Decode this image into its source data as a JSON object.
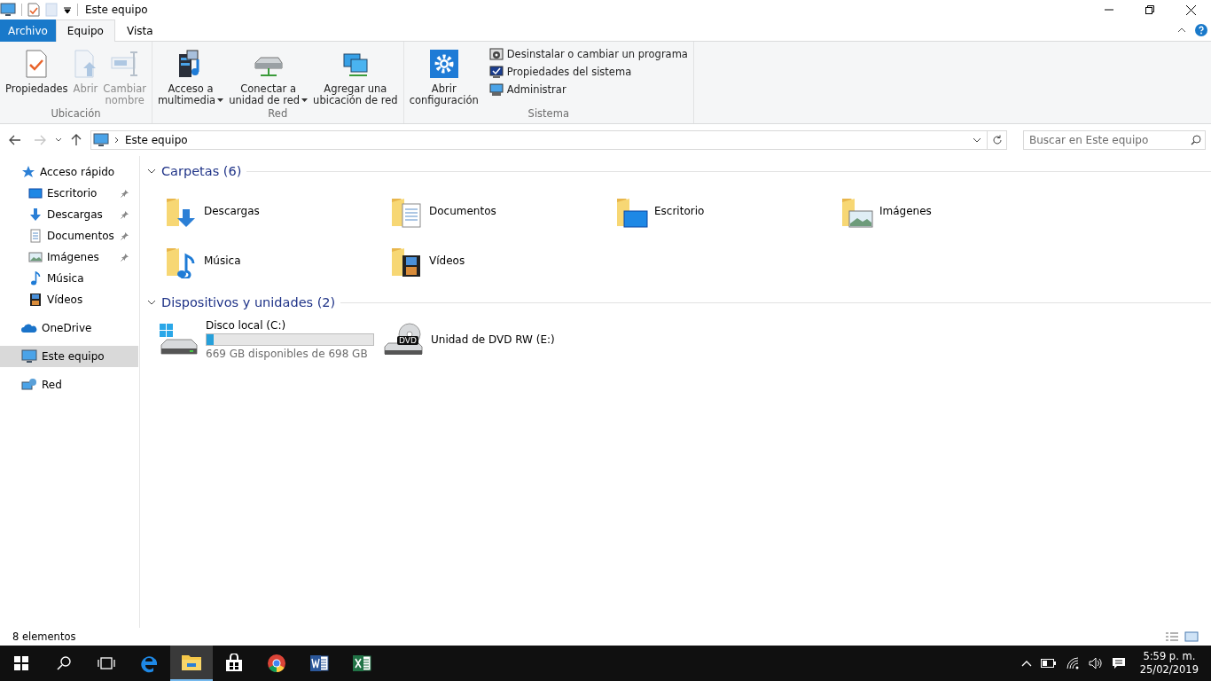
{
  "window": {
    "title": "Este equipo"
  },
  "ribbon_tabs": [
    {
      "label": "Archivo",
      "kind": "file",
      "selected": false
    },
    {
      "label": "Equipo",
      "kind": "tab",
      "selected": true
    },
    {
      "label": "Vista",
      "kind": "tab",
      "selected": false
    }
  ],
  "ribbon_groups": [
    {
      "title": "Ubicación",
      "commands": [
        {
          "lines": [
            "Propiedades"
          ],
          "kind": "properties",
          "disabled": false,
          "dropdown": false
        },
        {
          "lines": [
            "Abrir"
          ],
          "kind": "open",
          "disabled": true,
          "dropdown": false
        },
        {
          "lines": [
            "Cambiar",
            "nombre"
          ],
          "kind": "rename",
          "disabled": true,
          "dropdown": false
        }
      ]
    },
    {
      "title": "Red",
      "commands": [
        {
          "lines": [
            "Acceso a",
            "multimedia"
          ],
          "kind": "media",
          "disabled": false,
          "dropdown": true
        },
        {
          "lines": [
            "Conectar a",
            "unidad de red"
          ],
          "kind": "drive",
          "disabled": false,
          "dropdown": true
        },
        {
          "lines": [
            "Agregar una",
            "ubicación de red"
          ],
          "kind": "network",
          "disabled": false,
          "dropdown": false
        }
      ]
    },
    {
      "title": "Sistema",
      "commands": [
        {
          "lines": [
            "Abrir",
            "configuración"
          ],
          "kind": "settings",
          "disabled": false,
          "dropdown": false
        }
      ],
      "small_commands": [
        {
          "label": "Desinstalar o cambiar un programa",
          "kind": "uninstall"
        },
        {
          "label": "Propiedades del sistema",
          "kind": "sysprops"
        },
        {
          "label": "Administrar",
          "kind": "manage"
        }
      ]
    }
  ],
  "navigation": {
    "back_disabled": false,
    "forward_disabled": true,
    "address": "Este equipo",
    "search_placeholder": "Buscar en Este equipo"
  },
  "sidebar": {
    "items": [
      {
        "label": "Acceso rápido",
        "kind": "star",
        "pinned": false,
        "selected": false,
        "indent": false
      },
      {
        "label": "Escritorio",
        "kind": "desktop",
        "pinned": true,
        "selected": false,
        "indent": true
      },
      {
        "label": "Descargas",
        "kind": "download",
        "pinned": true,
        "selected": false,
        "indent": true
      },
      {
        "label": "Documentos",
        "kind": "document",
        "pinned": true,
        "selected": false,
        "indent": true
      },
      {
        "label": "Imágenes",
        "kind": "pictures",
        "pinned": true,
        "selected": false,
        "indent": true
      },
      {
        "label": "Música",
        "kind": "music",
        "pinned": false,
        "selected": false,
        "indent": true
      },
      {
        "label": "Vídeos",
        "kind": "videos",
        "pinned": false,
        "selected": false,
        "indent": true
      },
      {
        "label": "OneDrive",
        "kind": "cloud",
        "pinned": false,
        "selected": false,
        "indent": false
      },
      {
        "label": "Este equipo",
        "kind": "computer",
        "pinned": false,
        "selected": true,
        "indent": false
      },
      {
        "label": "Red",
        "kind": "network",
        "pinned": false,
        "selected": false,
        "indent": false
      }
    ]
  },
  "folders_section": {
    "title": "Carpetas (6)",
    "expanded": true,
    "items": [
      {
        "name": "Descargas",
        "kind": "download"
      },
      {
        "name": "Documentos",
        "kind": "document"
      },
      {
        "name": "Escritorio",
        "kind": "desktop"
      },
      {
        "name": "Imágenes",
        "kind": "pictures"
      },
      {
        "name": "Música",
        "kind": "music"
      },
      {
        "name": "Vídeos",
        "kind": "videos"
      }
    ]
  },
  "devices_section": {
    "title": "Dispositivos y unidades (2)",
    "expanded": true,
    "items": [
      {
        "name": "Disco local (C:)",
        "kind": "disk",
        "level": 0.04,
        "detail": "669 GB disponibles de 698 GB"
      },
      {
        "name": "Unidad de DVD RW (E:)",
        "kind": "dvd",
        "badge": "DVD"
      }
    ]
  },
  "status_bar": {
    "text": "8 elementos"
  },
  "taskbar": {
    "apps": [
      {
        "kind": "edge",
        "selected": false
      },
      {
        "kind": "explorer",
        "selected": true
      },
      {
        "kind": "store",
        "selected": false
      },
      {
        "kind": "chrome",
        "selected": false
      },
      {
        "kind": "word",
        "selected": false
      },
      {
        "kind": "excel",
        "selected": false
      }
    ],
    "time": "5:59 p. m.",
    "date": "25/02/2019"
  }
}
